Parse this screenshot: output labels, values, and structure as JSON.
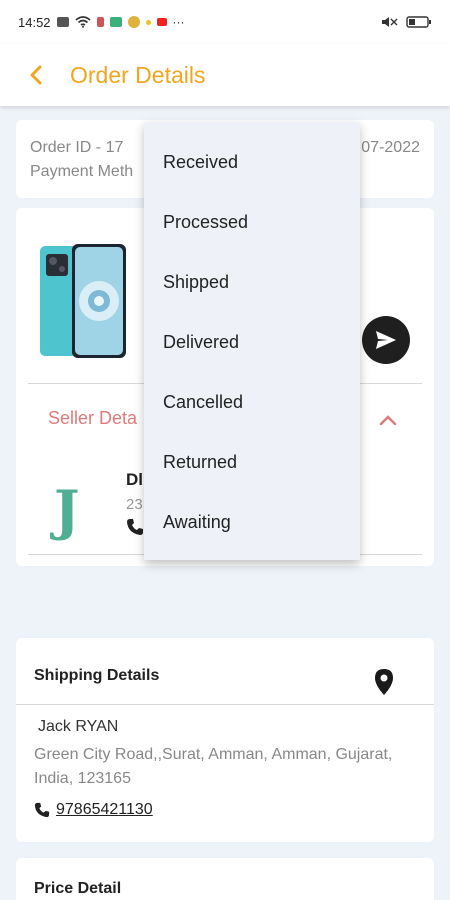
{
  "status_bar": {
    "time": "14:52",
    "more": "···"
  },
  "header": {
    "title": "Order Details"
  },
  "order": {
    "order_id_label": "Order ID - 17",
    "date_partial": "07-2022",
    "payment_label": "Payment Meth"
  },
  "seller": {
    "header": "Seller Deta",
    "logo_letter": "J",
    "name_partial": "Dl",
    "addr_partial": "23"
  },
  "shipping": {
    "title": "Shipping Details",
    "name": "Jack RYAN",
    "address": "Green City Road,,Surat, Amman, Amman, Gujarat, India, 123165",
    "phone": "97865421130"
  },
  "price": {
    "title": "Price Detail"
  },
  "status_menu": {
    "items": [
      "Received",
      "Processed",
      "Shipped",
      "Delivered",
      "Cancelled",
      "Returned",
      "Awaiting"
    ]
  },
  "colors": {
    "accent": "#f2a51f",
    "seller_header": "#e07a7a",
    "logo": "#4fae93",
    "background": "#eef2f9"
  },
  "icons": [
    "back-arrow-icon",
    "send-icon",
    "chevron-up-icon",
    "phone-icon",
    "location-pin-icon"
  ]
}
